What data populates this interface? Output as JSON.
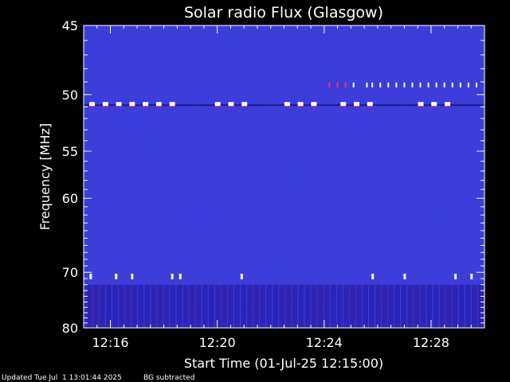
{
  "chart_data": {
    "type": "heatmap",
    "title": "Solar radio Flux (Glasgow)",
    "xlabel": "Start Time (01-Jul-25 12:15:00)",
    "ylabel": "Frequency [MHz]",
    "x_range_minutes": [
      0,
      15
    ],
    "x_start": "12:15",
    "x_ticks": [
      {
        "value": 1,
        "label": "12:16"
      },
      {
        "value": 5,
        "label": "12:20"
      },
      {
        "value": 9,
        "label": "12:24"
      },
      {
        "value": 13,
        "label": "12:28"
      }
    ],
    "ylim": [
      45,
      80
    ],
    "y_scale": "reciprocal",
    "y_ticks": [
      45,
      50,
      55,
      60,
      70,
      80
    ],
    "colors": {
      "background": "#1a1ab0",
      "band": "#fffbe0",
      "spike": "#ff3060",
      "bright": "#ffffff"
    },
    "events": {
      "band_50mhz_minutes": [
        0.3,
        0.8,
        1.3,
        1.8,
        2.3,
        2.8,
        3.3,
        5.0,
        5.5,
        6.0,
        7.6,
        8.1,
        8.6,
        9.7,
        10.2,
        10.7,
        12.6,
        13.1,
        13.6
      ],
      "spikes_49mhz_minutes": [
        9.2,
        9.5,
        9.8,
        10.1,
        10.6,
        10.8,
        11.1,
        11.4,
        11.7,
        12.0,
        12.3,
        12.6,
        12.9,
        13.2,
        13.5,
        13.8,
        14.1,
        14.4,
        14.7
      ],
      "bursts_70mhz_minutes": [
        0.25,
        1.2,
        1.8,
        3.3,
        3.6,
        5.9,
        10.8,
        12.0,
        13.9,
        14.5
      ]
    }
  },
  "footer": {
    "updated": "Updated Tue Jul  1 13:01:44 2025",
    "note": "BG subtracted"
  }
}
